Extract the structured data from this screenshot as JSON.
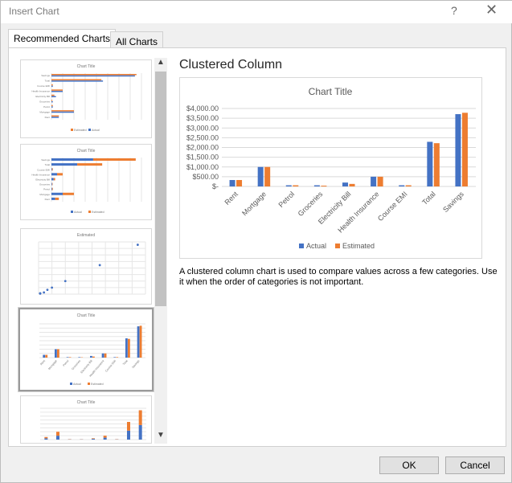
{
  "window": {
    "title": "Insert Chart",
    "help": "?",
    "close": "✕"
  },
  "tabs": [
    {
      "label": "Recommended Charts",
      "active": true
    },
    {
      "label": "All Charts",
      "active": false
    }
  ],
  "thumbnails": [
    {
      "type": "clustered-bar",
      "title": "Chart Title",
      "legend": [
        "Estimated",
        "Actual"
      ]
    },
    {
      "type": "stacked-bar",
      "title": "Chart Title",
      "legend": [
        "Actual",
        "Estimated"
      ]
    },
    {
      "type": "scatter",
      "title": "Estimated"
    },
    {
      "type": "clustered-column",
      "title": "Chart Title",
      "legend": [
        "Actual",
        "Estimated"
      ],
      "selected": true
    },
    {
      "type": "stacked-column",
      "title": "Chart Title"
    }
  ],
  "scrollbar": {
    "up": "▲",
    "down": "▼"
  },
  "preview": {
    "chart_type_name": "Clustered Column",
    "description": "A clustered column chart is used to compare values across a few categories. Use it when the order of categories is not important."
  },
  "chart_data": {
    "type": "bar",
    "title": "Chart Title",
    "categories": [
      "Rent",
      "Mortgage",
      "Petrol",
      "Groceries",
      "Electricity Bill",
      "Health Insurance",
      "Course EMI",
      "Total",
      "Savings"
    ],
    "series": [
      {
        "name": "Actual",
        "color": "#4472c4",
        "values": [
          330,
          1000,
          60,
          60,
          200,
          500,
          60,
          2290,
          3710
        ]
      },
      {
        "name": "Estimated",
        "color": "#ed7d31",
        "values": [
          330,
          1000,
          60,
          40,
          130,
          500,
          60,
          2220,
          3780
        ]
      }
    ],
    "yticks": [
      "$-",
      "$500.00",
      "$1,000.00",
      "$1,500.00",
      "$2,000.00",
      "$2,500.00",
      "$3,000.00",
      "$3,500.00",
      "$4,000.00"
    ],
    "ylim": [
      0,
      4000
    ],
    "grid": true,
    "legend": "bottom"
  },
  "buttons": {
    "ok": "OK",
    "cancel": "Cancel"
  }
}
